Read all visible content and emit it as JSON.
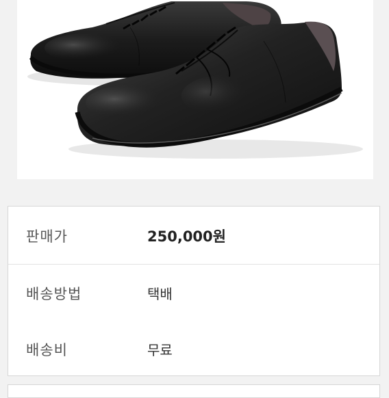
{
  "product_image": {
    "alt": "검정 가죽 스니커즈 한 켤레"
  },
  "details": {
    "price_label": "판매가",
    "price_value": "250,000원",
    "shipping_method_label": "배송방법",
    "shipping_method_value": "택배",
    "shipping_fee_label": "배송비",
    "shipping_fee_value": "무료"
  },
  "colors": {
    "panel_border": "#d6d6d6",
    "page_background": "#f2f2f2"
  }
}
